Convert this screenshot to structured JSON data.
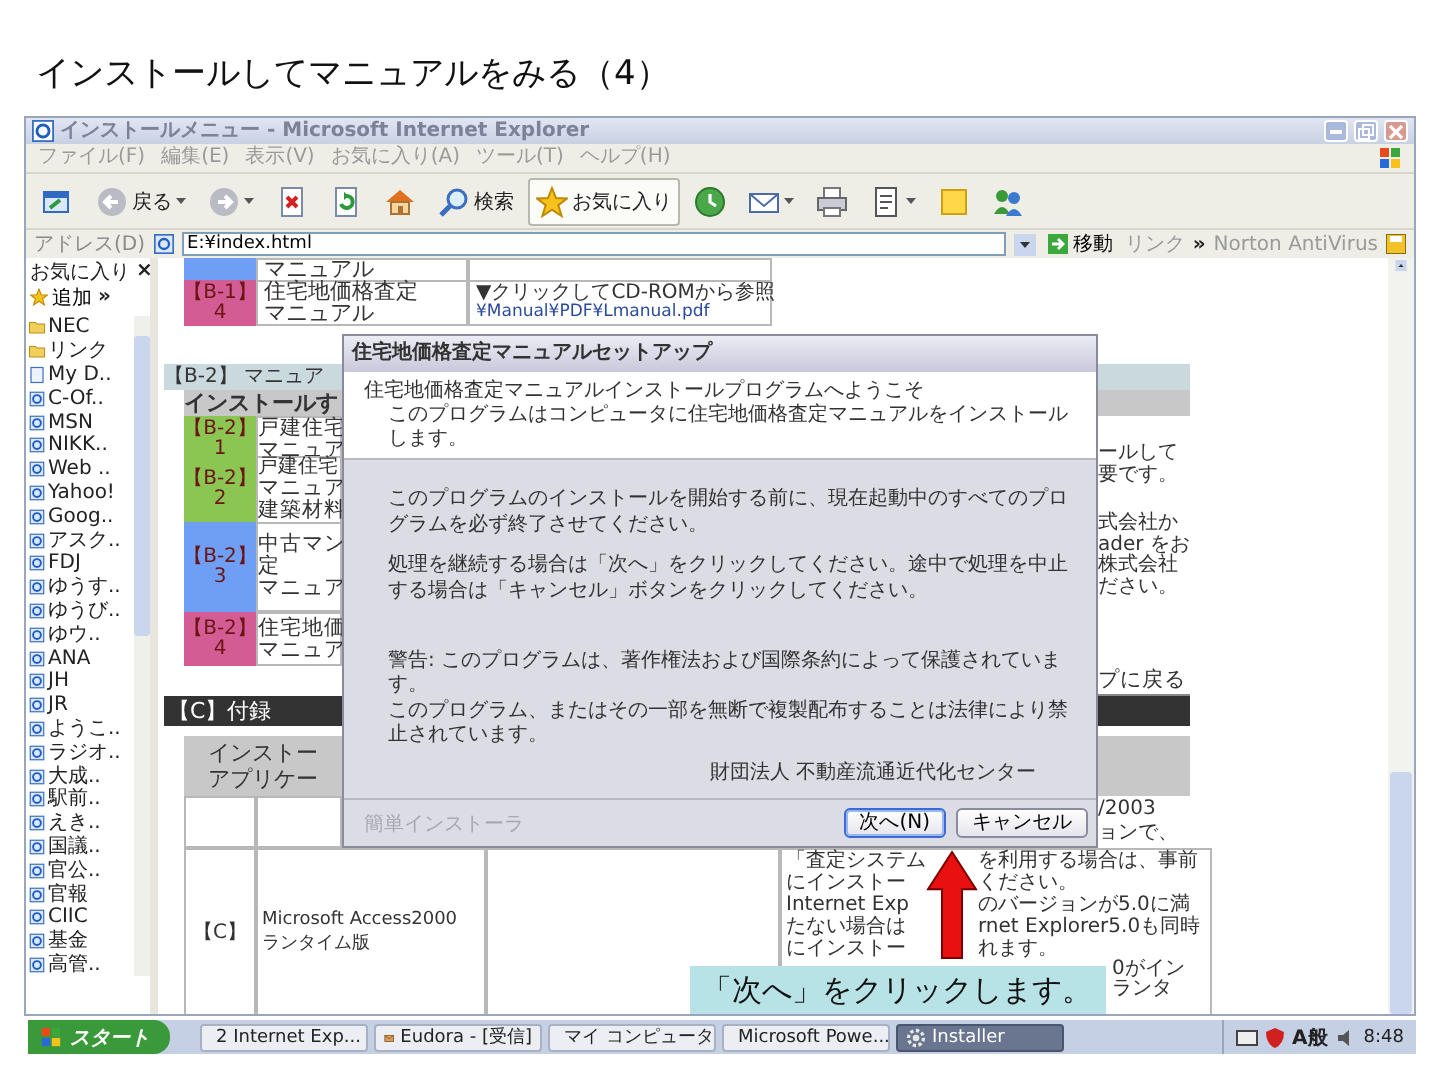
{
  "slide_title": "インストールしてマニュアルをみる（4）",
  "window": {
    "title": "インストールメニュー - Microsoft Internet Explorer",
    "menu": [
      "ファイル(F)",
      "編集(E)",
      "表示(V)",
      "お気に入り(A)",
      "ツール(T)",
      "ヘルプ(H)"
    ],
    "toolbar": [
      {
        "kind": "window",
        "selected": false,
        "dropdown": false
      },
      {
        "kind": "back",
        "label": "戻る",
        "selected": false,
        "dropdown": true
      },
      {
        "kind": "forward",
        "selected": false,
        "dropdown": true
      },
      {
        "kind": "stop",
        "selected": false,
        "dropdown": false
      },
      {
        "kind": "refresh",
        "selected": false,
        "dropdown": false
      },
      {
        "kind": "home",
        "selected": false,
        "dropdown": false
      },
      {
        "kind": "search",
        "label": "検索",
        "selected": false,
        "dropdown": false
      },
      {
        "kind": "favorites",
        "label": "お気に入り",
        "selected": true,
        "dropdown": false
      },
      {
        "kind": "history",
        "selected": false,
        "dropdown": false
      },
      {
        "kind": "mail",
        "selected": false,
        "dropdown": true
      },
      {
        "kind": "print",
        "selected": false,
        "dropdown": false
      },
      {
        "kind": "edit",
        "selected": false,
        "dropdown": true
      },
      {
        "kind": "notes",
        "selected": false,
        "dropdown": false
      },
      {
        "kind": "messenger",
        "selected": false,
        "dropdown": false
      }
    ],
    "address": {
      "label": "アドレス(D)",
      "value": "E:¥index.html",
      "go": "移動",
      "links": "リンク",
      "links_more": "»",
      "norton": "Norton AntiVirus"
    }
  },
  "favorites": {
    "title": "お気に入り",
    "close": "×",
    "add": "追加",
    "add_more": "»",
    "items": [
      {
        "label": "NEC",
        "kind": "folder"
      },
      {
        "label": "リンク",
        "kind": "folder"
      },
      {
        "label": "My D..",
        "kind": "page"
      },
      {
        "label": "C-Of..",
        "kind": "link"
      },
      {
        "label": "MSN",
        "kind": "link"
      },
      {
        "label": "NIKK..",
        "kind": "link"
      },
      {
        "label": "Web ..",
        "kind": "link"
      },
      {
        "label": "Yahoo!",
        "kind": "link"
      },
      {
        "label": "Goog..",
        "kind": "link"
      },
      {
        "label": "アスク..",
        "kind": "link"
      },
      {
        "label": "FDJ",
        "kind": "link"
      },
      {
        "label": "ゆうす..",
        "kind": "link"
      },
      {
        "label": "ゆうび..",
        "kind": "link"
      },
      {
        "label": "ゆウ..",
        "kind": "link"
      },
      {
        "label": "ANA",
        "kind": "link"
      },
      {
        "label": "JH",
        "kind": "link"
      },
      {
        "label": "JR",
        "kind": "link"
      },
      {
        "label": "ようこ..",
        "kind": "link"
      },
      {
        "label": "ラジオ..",
        "kind": "link"
      },
      {
        "label": "大成..",
        "kind": "link"
      },
      {
        "label": "駅前..",
        "kind": "link"
      },
      {
        "label": "えき..",
        "kind": "link"
      },
      {
        "label": "国議..",
        "kind": "link"
      },
      {
        "label": "官公..",
        "kind": "link"
      },
      {
        "label": "官報",
        "kind": "link"
      },
      {
        "label": "CIIC",
        "kind": "link"
      },
      {
        "label": "基金",
        "kind": "link"
      },
      {
        "label": "高管..",
        "kind": "link"
      }
    ]
  },
  "content": {
    "top_rows": [
      {
        "color": "#6f9ff5",
        "name": [
          "マニュアル"
        ]
      },
      {
        "color": "#d45c95",
        "tag": [
          "【B-1】",
          "4"
        ],
        "name": [
          "住宅地価格査定",
          "マニュアル"
        ],
        "link": "▼クリックしてCD-ROMから参照",
        "path": "¥Manual¥PDF¥Lmanual.pdf"
      }
    ],
    "b2": {
      "title": "【B-2】 マニュア",
      "header": "インストールす",
      "rows": [
        {
          "color": "#8cc652",
          "tag": [
            "【B-2】",
            "1"
          ],
          "name": [
            "戸建住宅",
            "マニュア"
          ]
        },
        {
          "color": "#8cc652",
          "tag": [
            "【B-2】",
            "2"
          ],
          "caption": "戸建住宅",
          "name": [
            "マニュア",
            "建築材料"
          ]
        },
        {
          "color": "#6f9ff5",
          "tag": [
            "【B-2】",
            "3"
          ],
          "name": [
            "中古マン",
            "定",
            "マニュア"
          ]
        },
        {
          "color": "#d45c95",
          "tag": [
            "【B-2】",
            "4"
          ],
          "name": [
            "住宅地価",
            "マニュア"
          ]
        }
      ],
      "notes": [
        [
          "ールして",
          "要です。"
        ],
        [
          "式会社か",
          "ader をお",
          "株式会社",
          "ださい。"
        ]
      ],
      "back_link": "プに戻る"
    },
    "c": {
      "title": "【C】付録",
      "header": [
        "インストー",
        "アプリケー"
      ],
      "note_top": [
        "/2003",
        "ョンで、"
      ],
      "tag": "【C】",
      "name": [
        "Microsoft Access2000",
        "ランタイム版"
      ],
      "note_lines": [
        [
          "「査定システム",
          "を利用する場合は、事前"
        ],
        [
          "にインストー",
          "ください。"
        ],
        [
          "Internet Exp",
          "のバージョンが5.0に満"
        ],
        [
          "たない場合は",
          "rnet Explorer5.0も同時"
        ],
        [
          "にインストー",
          "れます。"
        ]
      ],
      "note_tail": [
        "0がイン",
        "ランタ"
      ]
    }
  },
  "dialog": {
    "title": "住宅地価格査定マニュアルセットアップ",
    "welcome": "住宅地価格査定マニュアルインストールプログラムへようこそ",
    "intro": "このプログラムはコンピュータに住宅地価格査定マニュアルをインストールします。",
    "body": [
      "このプログラムのインストールを開始する前に、現在起動中のすべてのプログラムを必ず終了させてください。",
      "処理を継続する場合は「次へ」をクリックしてください。途中で処理を中止する場合は「キャンセル」ボタンをクリックしてください。"
    ],
    "warning": [
      "警告: このプログラムは、著作権法および国際条約によって保護されています。",
      "このプログラム、またはその一部を無断で複製配布することは法律により禁止されています。"
    ],
    "publisher": "財団法人 不動産流通近代化センター",
    "brand": "簡単インストーラ",
    "buttons": [
      {
        "label": "次へ(N)",
        "default": true
      },
      {
        "label": "キャンセル",
        "default": false
      }
    ]
  },
  "callout": "「次へ」をクリックします。",
  "taskbar": {
    "start": "スタート",
    "tasks": [
      {
        "label": "2 Internet Exp...",
        "kind": "ie",
        "selected": false
      },
      {
        "label": "Eudora - [受信]",
        "kind": "mail",
        "selected": false
      },
      {
        "label": "マイ コンピュータ",
        "kind": "computer",
        "selected": false
      },
      {
        "label": "Microsoft Powe...",
        "kind": "slides",
        "selected": false
      },
      {
        "label": "Installer",
        "kind": "installer",
        "selected": true
      }
    ],
    "ime": "A般",
    "clock": "8:48"
  }
}
